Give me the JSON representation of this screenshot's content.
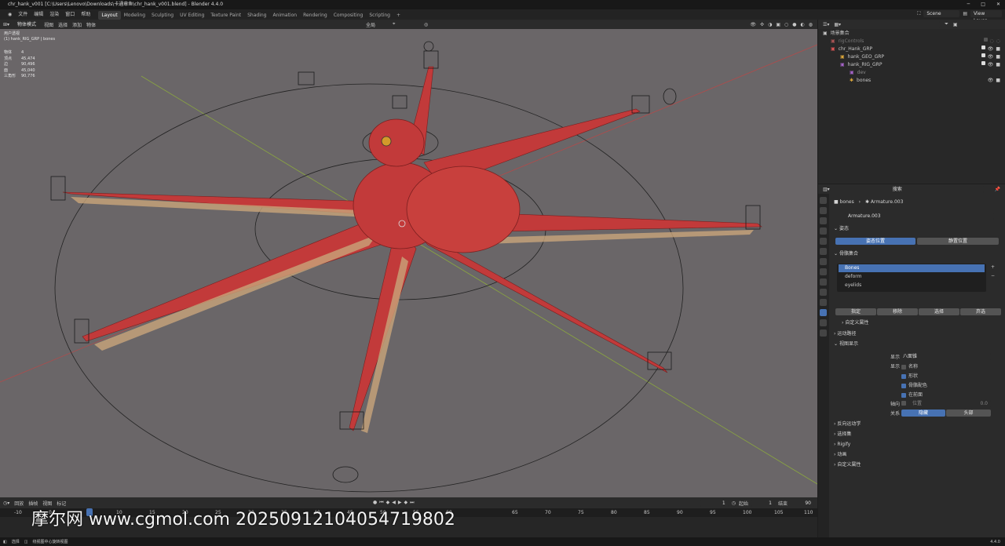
{
  "window": {
    "title": "chr_hank_v001 [C:\\Users\\Lenovo\\Downloads\\卡通章鱼\\chr_hank_v001.blend] - Blender 4.4.0"
  },
  "menubar": {
    "menus": [
      "文件",
      "编辑",
      "渲染",
      "窗口",
      "帮助"
    ],
    "tabs": [
      "Layout",
      "Modeling",
      "Sculpting",
      "UV Editing",
      "Texture Paint",
      "Shading",
      "Animation",
      "Rendering",
      "Compositing",
      "Scripting"
    ],
    "add_tab": "+",
    "scene": "Scene",
    "view_layer": "View Layer"
  },
  "viewport_header": {
    "mode": "物体模式",
    "menus": [
      "视图",
      "选择",
      "添加",
      "物体"
    ],
    "transform": "全局"
  },
  "viewport": {
    "info_line1": "用户透视",
    "info_line2": "(1) hank_RIG_GRP | bones",
    "stats": [
      {
        "k": "物体",
        "v": "4"
      },
      {
        "k": "顶点",
        "v": "45,474"
      },
      {
        "k": "边",
        "v": "90,496"
      },
      {
        "k": "面",
        "v": "45,040"
      },
      {
        "k": "三角形",
        "v": "90,776"
      }
    ]
  },
  "timeline": {
    "menus": [
      "回放",
      "插帧",
      "视图",
      "标记"
    ],
    "current_frame": "1",
    "start_label": "起始",
    "start": "1",
    "end_label": "结束",
    "end": "90",
    "ruler": [
      "-10",
      "0",
      "10",
      "15",
      "20",
      "25",
      "30",
      "35",
      "40",
      "45",
      "50",
      "55",
      "60",
      "65",
      "70",
      "75",
      "80",
      "85",
      "90",
      "95",
      "100",
      "105",
      "110"
    ]
  },
  "statusbar": {
    "select": "选择",
    "rotate": "绕视图中心旋转视图",
    "version": "4.4.0"
  },
  "outliner": {
    "search_placeholder": "",
    "root": "场景集合",
    "rows": [
      {
        "name": "rigControls",
        "indent": 1,
        "dim": true
      },
      {
        "name": "chr_Hank_GRP",
        "indent": 1
      },
      {
        "name": "hank_GEO_GRP",
        "indent": 2
      },
      {
        "name": "hank_RIG_GRP",
        "indent": 2
      },
      {
        "name": "dev",
        "indent": 3
      },
      {
        "name": "bones",
        "indent": 3
      }
    ]
  },
  "properties": {
    "search_placeholder": "搜索",
    "breadcrumb_obj": "bones",
    "breadcrumb_data": "Armature.003",
    "datablock": "Armature.003",
    "pose_section": "姿态",
    "pose_position": "姿态位置",
    "rest_position": "静置位置",
    "bone_collections": "骨骼集合",
    "collections": [
      "Bones",
      "deform",
      "eyelids"
    ],
    "assign": "指定",
    "remove": "移除",
    "select": "选择",
    "deselect": "弃选",
    "custom_props_sub": "自定义属性",
    "motion_paths": "运动路径",
    "viewport_display": "视图显示",
    "display_as_label": "显示为",
    "display_as": "八面锥",
    "show_label": "显示",
    "show_names": "名称",
    "show_shapes": "形状",
    "show_group_colors": "骨骼配色",
    "show_in_front": "在前面",
    "axes_label": "轴向",
    "axes_field": "位置",
    "axes_value": "0.0",
    "relations_label": "关系",
    "relations_on": "隐藏",
    "relations_off": "头部",
    "sections": [
      "反向运动学",
      "选择集",
      "Rigify",
      "动画",
      "自定义属性"
    ]
  },
  "watermark": "摩尔网 www.cgmol.com 20250912104054719802",
  "colors": {
    "accent": "#4772b3",
    "octopus": "#c23a3a",
    "viewport_bg": "#6a6668"
  }
}
